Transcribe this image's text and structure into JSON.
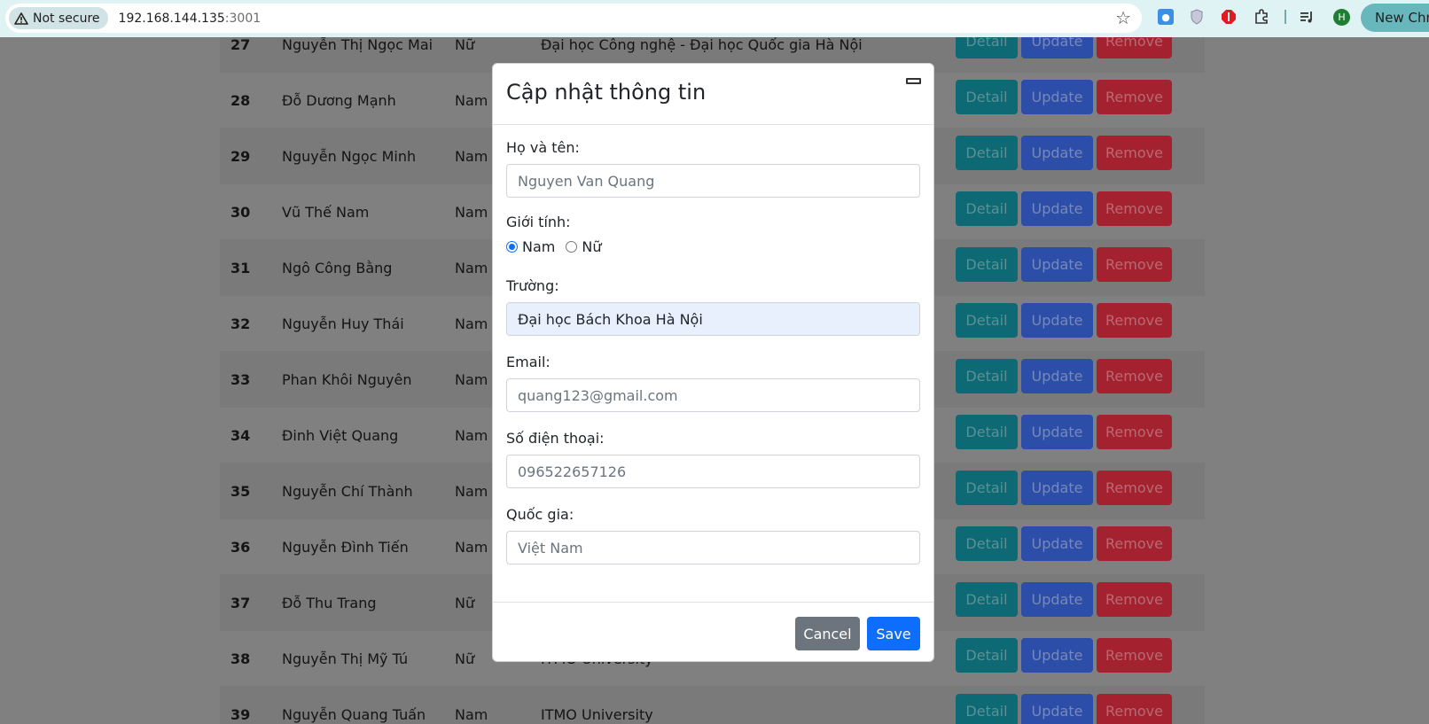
{
  "browser": {
    "security_label": "Not secure",
    "url_host": "192.168.144.135",
    "url_port": ":3001",
    "avatar_letter": "H",
    "new_chrome_label": "New Chrome"
  },
  "table": {
    "rows": [
      {
        "id": "27",
        "name": "Nguyễn Thị Ngọc Mai",
        "gender": "Nữ",
        "school": "Đại học Công nghệ - Đại học Quốc gia Hà Nội"
      },
      {
        "id": "28",
        "name": "Đỗ Dương Mạnh",
        "gender": "Nam",
        "school": ""
      },
      {
        "id": "29",
        "name": "Nguyễn Ngọc Minh",
        "gender": "Nam",
        "school": ""
      },
      {
        "id": "30",
        "name": "Vũ Thế Nam",
        "gender": "Nam",
        "school": ""
      },
      {
        "id": "31",
        "name": "Ngô Công Bằng",
        "gender": "Nam",
        "school": ""
      },
      {
        "id": "32",
        "name": "Nguyễn Huy Thái",
        "gender": "Nam",
        "school": ""
      },
      {
        "id": "33",
        "name": "Phan Khôi Nguyên",
        "gender": "Nam",
        "school": ""
      },
      {
        "id": "34",
        "name": "Đinh Việt Quang",
        "gender": "Nam",
        "school": ""
      },
      {
        "id": "35",
        "name": "Nguyễn Chí Thành",
        "gender": "Nam",
        "school": ""
      },
      {
        "id": "36",
        "name": "Nguyễn Đình Tiến",
        "gender": "Nam",
        "school": ""
      },
      {
        "id": "37",
        "name": "Đỗ Thu Trang",
        "gender": "Nữ",
        "school": ""
      },
      {
        "id": "38",
        "name": "Nguyễn Thị Mỹ Tú",
        "gender": "Nữ",
        "school": "ITMO University"
      },
      {
        "id": "39",
        "name": "Nguyễn Quang Tuấn",
        "gender": "Nam",
        "school": "ITMO University"
      }
    ],
    "actions": {
      "detail": "Detail",
      "update": "Update",
      "remove": "Remove"
    }
  },
  "modal": {
    "title": "Cập nhật thông tin",
    "name_label": "Họ và tên:",
    "name_value": "Nguyen Van Quang",
    "gender_label": "Giới tính:",
    "gender_options": [
      "Nam",
      "Nữ"
    ],
    "gender_selected": "Nam",
    "school_label": "Trường:",
    "school_value": "Đại học Bách Khoa Hà Nội",
    "email_label": "Email:",
    "email_value": "quang123@gmail.com",
    "phone_label": "Số điện thoại:",
    "phone_value": "096522657126",
    "country_label": "Quốc gia:",
    "country_value": "Việt Nam",
    "cancel_label": "Cancel",
    "save_label": "Save"
  }
}
